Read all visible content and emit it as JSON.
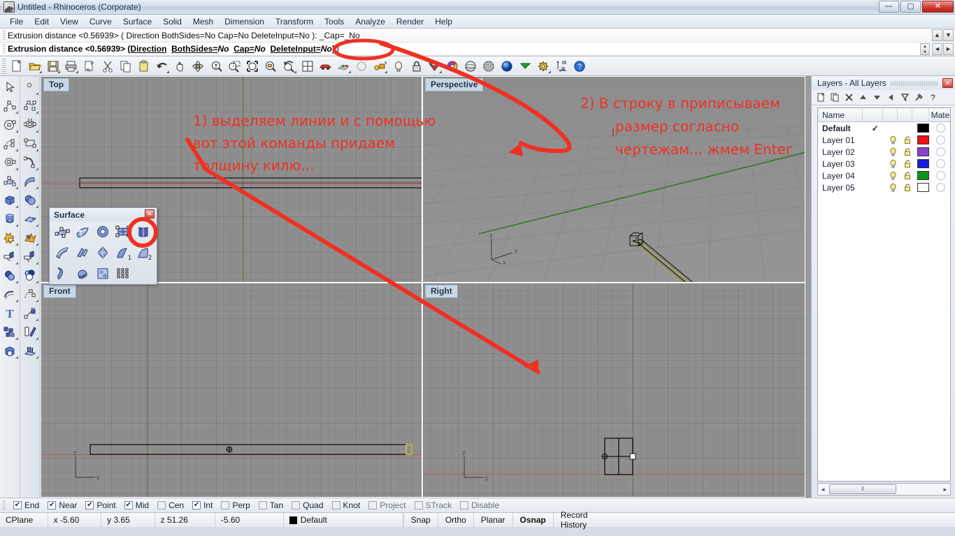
{
  "window": {
    "title": "Untitled - Rhinoceros (Corporate)",
    "icon": "rhino-logo-icon",
    "buttons": {
      "minimize": "—",
      "maximize": "▢",
      "close": "✕"
    }
  },
  "menu": {
    "items": [
      "File",
      "Edit",
      "View",
      "Curve",
      "Surface",
      "Solid",
      "Mesh",
      "Dimension",
      "Transform",
      "Tools",
      "Analyze",
      "Render",
      "Help"
    ]
  },
  "command": {
    "history_line": "Extrusion distance <0.56939> ( Direction  BothSides=No  Cap=No  DeleteInput=No ): _Cap=_No",
    "prompt_parts": {
      "label": "Extrusion distance <0.56939> ( ",
      "opt1": "Direction",
      "opt2": "BothSides=",
      "val2": "No",
      "opt3": "Cap=",
      "val3": "No",
      "opt4": "DeleteInput=",
      "val4": "No",
      "tail": " ): "
    },
    "input_value": ""
  },
  "toolbar": {
    "items": [
      {
        "name": "new-file-icon",
        "tip": "New"
      },
      {
        "name": "open-file-icon",
        "tip": "Open"
      },
      {
        "name": "save-file-icon",
        "tip": "Save"
      },
      {
        "name": "print-icon",
        "tip": "Print"
      },
      {
        "name": "copy-to-clipboard-icon",
        "tip": "Copy to clipboard"
      },
      {
        "name": "cut-icon",
        "tip": "Cut"
      },
      {
        "name": "copy-icon",
        "tip": "Copy"
      },
      {
        "name": "paste-icon",
        "tip": "Paste"
      },
      {
        "name": "undo-icon",
        "tip": "Undo"
      },
      {
        "name": "pan-hand-icon",
        "tip": "Pan"
      },
      {
        "name": "rotate-view-icon",
        "tip": "Rotate view"
      },
      {
        "name": "zoom-in-out-icon",
        "tip": "Zoom"
      },
      {
        "name": "zoom-window-icon",
        "tip": "Zoom window"
      },
      {
        "name": "zoom-extents-icon",
        "tip": "Zoom extents"
      },
      {
        "name": "zoom-selected-icon",
        "tip": "Zoom selected"
      },
      {
        "name": "undo-view-icon",
        "tip": "Undo view change"
      },
      {
        "name": "four-viewport-icon",
        "tip": "4 viewports"
      },
      {
        "name": "car-icon",
        "tip": "Named views"
      },
      {
        "name": "grid-snap-icon",
        "tip": "Grid"
      },
      {
        "name": "circle-tool-icon",
        "tip": "Circle"
      },
      {
        "name": "object-properties-icon",
        "tip": "Properties"
      },
      {
        "name": "light-bulb-icon",
        "tip": "Lights"
      },
      {
        "name": "lock-icon",
        "tip": "Lock"
      },
      {
        "name": "render-color-icon",
        "tip": "Render"
      },
      {
        "name": "color-wheel-icon",
        "tip": "Color"
      },
      {
        "name": "shade-sphere-icon",
        "tip": "Shade"
      },
      {
        "name": "ghosted-sphere-icon",
        "tip": "Ghosted"
      },
      {
        "name": "rendered-sphere-icon",
        "tip": "Rendered"
      },
      {
        "name": "flag-icon",
        "tip": "Flag"
      },
      {
        "name": "options-gear-icon",
        "tip": "Options"
      },
      {
        "name": "dimension-icon",
        "tip": "Dimension"
      },
      {
        "name": "help-icon",
        "tip": "Help"
      }
    ]
  },
  "sidetools": {
    "left_column": [
      {
        "name": "select-arrow-icon"
      },
      {
        "name": "polyline-icon"
      },
      {
        "name": "circle-icon"
      },
      {
        "name": "arc-icon"
      },
      {
        "name": "polygon-icon"
      },
      {
        "name": "surface-from-points-icon"
      },
      {
        "name": "box-solid-icon"
      },
      {
        "name": "cylinder-icon"
      },
      {
        "name": "boolean-star-icon"
      },
      {
        "name": "fillet-icon"
      },
      {
        "name": "boolean-union-icon"
      },
      {
        "name": "boolean-difference-icon"
      },
      {
        "name": "curve-offset-icon"
      },
      {
        "name": "text-tool-icon"
      },
      {
        "name": "group-icon"
      },
      {
        "name": "render-box-icon"
      }
    ],
    "right_column": [
      {
        "name": "point-icon"
      },
      {
        "name": "curve-interpolate-icon"
      },
      {
        "name": "ellipse-icon"
      },
      {
        "name": "rectangle-icon"
      },
      {
        "name": "curve-blend-icon"
      },
      {
        "name": "surface-sweep-icon"
      },
      {
        "name": "sphere-icon"
      },
      {
        "name": "surface-plane-icon"
      },
      {
        "name": "explode-icon"
      },
      {
        "name": "trim-icon"
      },
      {
        "name": "boolean-intersection-icon"
      },
      {
        "name": "array-curve-icon"
      },
      {
        "name": "move-icon"
      },
      {
        "name": "mirror-icon"
      },
      {
        "name": "extrude-icon"
      }
    ]
  },
  "viewports": [
    {
      "name": "top-viewport",
      "label": "Top"
    },
    {
      "name": "perspective-viewport",
      "label": "Perspective"
    },
    {
      "name": "front-viewport",
      "label": "Front"
    },
    {
      "name": "right-viewport",
      "label": "Right"
    }
  ],
  "axis_labels": {
    "x": "x",
    "y": "y",
    "z": "z"
  },
  "surface_toolbar": {
    "title": "Surface",
    "close": "✕",
    "rows": [
      [
        {
          "name": "surface-from-control-points-icon",
          "label": ""
        },
        {
          "name": "surface-from-edge-curves-icon",
          "label": ""
        },
        {
          "name": "surface-from-planar-curves-icon",
          "label": ""
        },
        {
          "name": "surface-from-network-icon",
          "label": ""
        },
        {
          "name": "extrude-surface-straight-icon",
          "label": "",
          "highlighted": true
        }
      ],
      [
        {
          "name": "surface-sweep-1-rail-icon",
          "label": ""
        },
        {
          "name": "surface-sweep-2-rail-icon",
          "label": ""
        },
        {
          "name": "surface-loft-icon",
          "label": ""
        },
        {
          "name": "revolve-surface-icon",
          "label": "1"
        },
        {
          "name": "rail-revolve-icon",
          "label": "2"
        }
      ],
      [
        {
          "name": "surface-blend-icon",
          "label": ""
        },
        {
          "name": "surface-patch-icon",
          "label": ""
        },
        {
          "name": "surface-heightfield-icon",
          "label": ""
        },
        {
          "name": "surface-grid-icon",
          "label": ""
        }
      ]
    ]
  },
  "layers_panel": {
    "title": "Layers - All Layers",
    "close": "✕",
    "tools": [
      {
        "name": "new-layer-icon"
      },
      {
        "name": "duplicate-layer-icon"
      },
      {
        "name": "delete-layer-icon"
      },
      {
        "name": "move-layer-up-icon"
      },
      {
        "name": "move-layer-down-icon"
      },
      {
        "name": "collapse-layer-icon"
      },
      {
        "name": "filter-layer-icon"
      },
      {
        "name": "layer-tools-icon"
      },
      {
        "name": "layer-help-icon"
      }
    ],
    "columns": [
      "Name",
      "",
      "",
      "",
      "",
      "Mater"
    ],
    "rows": [
      {
        "name": "Default",
        "current": "✓",
        "bulb": false,
        "lock": false,
        "color": "#000000",
        "current_layer": true
      },
      {
        "name": "Layer 01",
        "current": "",
        "bulb": true,
        "lock": true,
        "color": "#ee1111",
        "current_layer": false
      },
      {
        "name": "Layer 02",
        "current": "",
        "bulb": true,
        "lock": true,
        "color": "#8a3fd1",
        "current_layer": false
      },
      {
        "name": "Layer 03",
        "current": "",
        "bulb": true,
        "lock": true,
        "color": "#1a1ae0",
        "current_layer": false
      },
      {
        "name": "Layer 04",
        "current": "",
        "bulb": true,
        "lock": true,
        "color": "#0b9418",
        "current_layer": false
      },
      {
        "name": "Layer 05",
        "current": "",
        "bulb": true,
        "lock": true,
        "color": "#ffffff",
        "current_layer": false
      }
    ],
    "scroll": {
      "left_arrow": "◄",
      "right_arrow": "►",
      "thumb": "⦀"
    }
  },
  "osnap": {
    "options": [
      {
        "label": "End",
        "checked": true,
        "dim": false
      },
      {
        "label": "Near",
        "checked": true,
        "dim": false
      },
      {
        "label": "Point",
        "checked": true,
        "dim": false
      },
      {
        "label": "Mid",
        "checked": true,
        "dim": false
      },
      {
        "label": "Cen",
        "checked": false,
        "dim": false
      },
      {
        "label": "Int",
        "checked": true,
        "dim": false
      },
      {
        "label": "Perp",
        "checked": false,
        "dim": false
      },
      {
        "label": "Tan",
        "checked": false,
        "dim": false
      },
      {
        "label": "Quad",
        "checked": false,
        "dim": false
      },
      {
        "label": "Knot",
        "checked": false,
        "dim": false
      },
      {
        "label": "Project",
        "checked": false,
        "dim": true
      },
      {
        "label": "STrack",
        "checked": false,
        "dim": true
      },
      {
        "label": "Disable",
        "checked": false,
        "dim": true
      }
    ]
  },
  "statusbar": {
    "cplane": "CPlane",
    "x": "x -5.60",
    "y": "y 3.65",
    "z": "z 51.26",
    "extra": "-5.60",
    "layer": "Default",
    "layer_color": "#000000",
    "toggles": [
      {
        "label": "Snap",
        "on": false
      },
      {
        "label": "Ortho",
        "on": false
      },
      {
        "label": "Planar",
        "on": false
      },
      {
        "label": "Osnap",
        "on": true
      },
      {
        "label": "Record History",
        "on": false
      }
    ]
  },
  "annotations": {
    "accent_color": "#ef3124",
    "note1": {
      "lines": [
        "1) выделяем линии и с помощью",
        "вот этой команды придаем",
        "толщину килю..."
      ]
    },
    "note2": {
      "lines": [
        "2) В строку в приписываем",
        "размер согласно",
        "чертежам... жмем Enter"
      ]
    }
  }
}
